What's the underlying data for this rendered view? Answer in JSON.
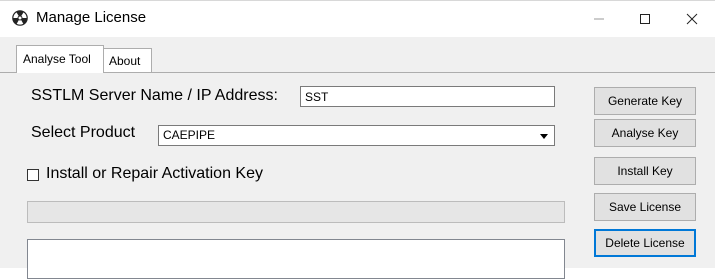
{
  "window": {
    "title": "Manage License",
    "icon": "radioactive-icon",
    "controls": [
      "minimize",
      "maximize",
      "close"
    ]
  },
  "tabs": [
    {
      "label": "Analyse Tool",
      "active": true
    },
    {
      "label": "About",
      "active": false
    }
  ],
  "form": {
    "server_label": "SSTLM Server Name / IP Address:",
    "server_value": "SST",
    "product_label": "Select Product",
    "product_selected": "CAEPIPE",
    "activation_label": "Install or Repair Activation Key",
    "activation_checked": false,
    "progress_percent": 0,
    "log_text": ""
  },
  "buttons": {
    "generate_key": "Generate Key",
    "analyse_key": "Analyse Key",
    "install_key": "Install Key",
    "save_license": "Save License",
    "delete_license": "Delete License"
  },
  "colors": {
    "panel_bg": "#f0f0f0",
    "button_face": "#e1e1e1",
    "default_button_border": "#0078d7"
  }
}
